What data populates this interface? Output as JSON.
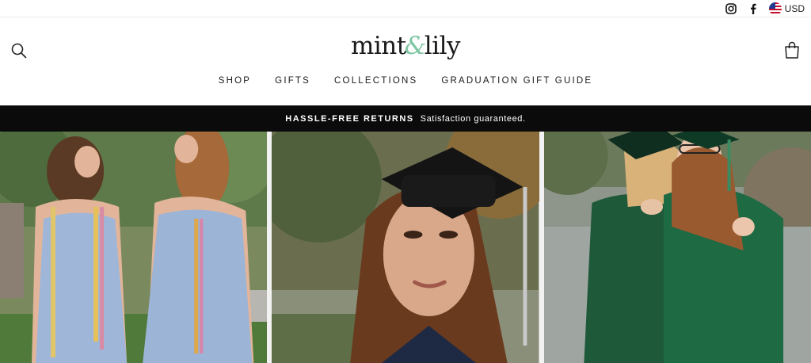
{
  "topbar": {
    "currency_code": "USD",
    "icons": [
      "instagram-icon",
      "facebook-icon",
      "us-flag-icon"
    ]
  },
  "header": {
    "logo_left": "mint",
    "logo_amp": "&",
    "logo_right": "lily",
    "icons": [
      "search-icon",
      "cart-icon"
    ]
  },
  "nav": {
    "items": [
      {
        "label": "SHOP"
      },
      {
        "label": "GIFTS"
      },
      {
        "label": "COLLECTIONS"
      },
      {
        "label": "GRADUATION GIFT GUIDE"
      }
    ]
  },
  "announcement": {
    "title": "HASSLE-FREE RETURNS",
    "text": "Satisfaction guaranteed."
  },
  "colors": {
    "brand_accent": "#7fc6a4",
    "announcement_bg": "#0b0b0b",
    "text": "#1a1a1a"
  },
  "hero": {
    "panels": [
      "two-graduates-blue-dresses-photo",
      "graduate-cap-portrait-photo",
      "graduates-hugging-green-gowns-photo"
    ]
  }
}
